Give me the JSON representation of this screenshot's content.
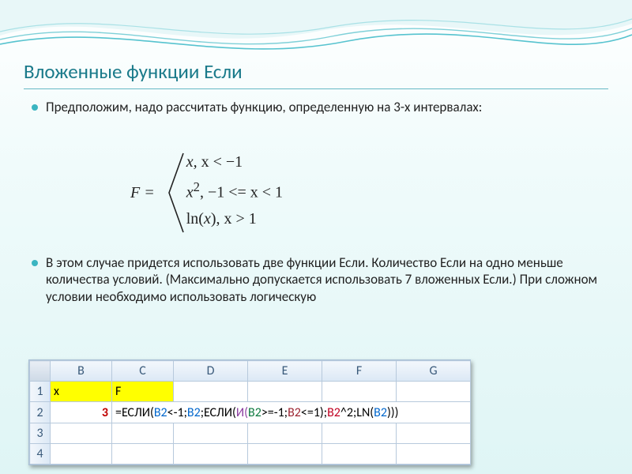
{
  "title": "Вложенные функции Если",
  "bullet1": "Предположим, надо рассчитать функцию, определенную на 3-х интервалах:",
  "bullet2": "В этом случае придется использовать две функции Если. Количество Если на одно меньше количества условий. (Максимально допускается использовать 7 вложенных Если.) При сложном условии необходимо использовать логическую",
  "formula": {
    "lhs": "F =",
    "row1a": "x,  ",
    "row1b": "x < −1",
    "row2a": "x",
    "row2sup": "2",
    "row2b": ", −1 <= x < 1",
    "row3a": "ln(",
    "row3b": "x",
    "row3c": "), x > 1"
  },
  "excel": {
    "cols": [
      "B",
      "C",
      "D",
      "E",
      "F",
      "G"
    ],
    "rows": [
      "1",
      "2",
      "3",
      "4"
    ],
    "r1": {
      "b": "x",
      "c": "F"
    },
    "r2": {
      "b": "3"
    },
    "formula_tokens": [
      {
        "t": "=",
        "c": "black"
      },
      {
        "t": "ЕСЛИ(",
        "c": "black"
      },
      {
        "t": "B2",
        "c": "blue"
      },
      {
        "t": "<-1;",
        "c": "black"
      },
      {
        "t": "B2",
        "c": "blue"
      },
      {
        "t": ";",
        "c": "black"
      },
      {
        "t": "ЕСЛИ(",
        "c": "black"
      },
      {
        "t": "И(",
        "c": "purple"
      },
      {
        "t": "B2",
        "c": "green"
      },
      {
        "t": ">=-1;",
        "c": "black"
      },
      {
        "t": "B2",
        "c": "darkred"
      },
      {
        "t": "<=1);",
        "c": "black"
      },
      {
        "t": "B2",
        "c": "red"
      },
      {
        "t": "^2;",
        "c": "black"
      },
      {
        "t": "LN(",
        "c": "black"
      },
      {
        "t": "B2",
        "c": "blue"
      },
      {
        "t": ")))",
        "c": "black"
      }
    ]
  }
}
